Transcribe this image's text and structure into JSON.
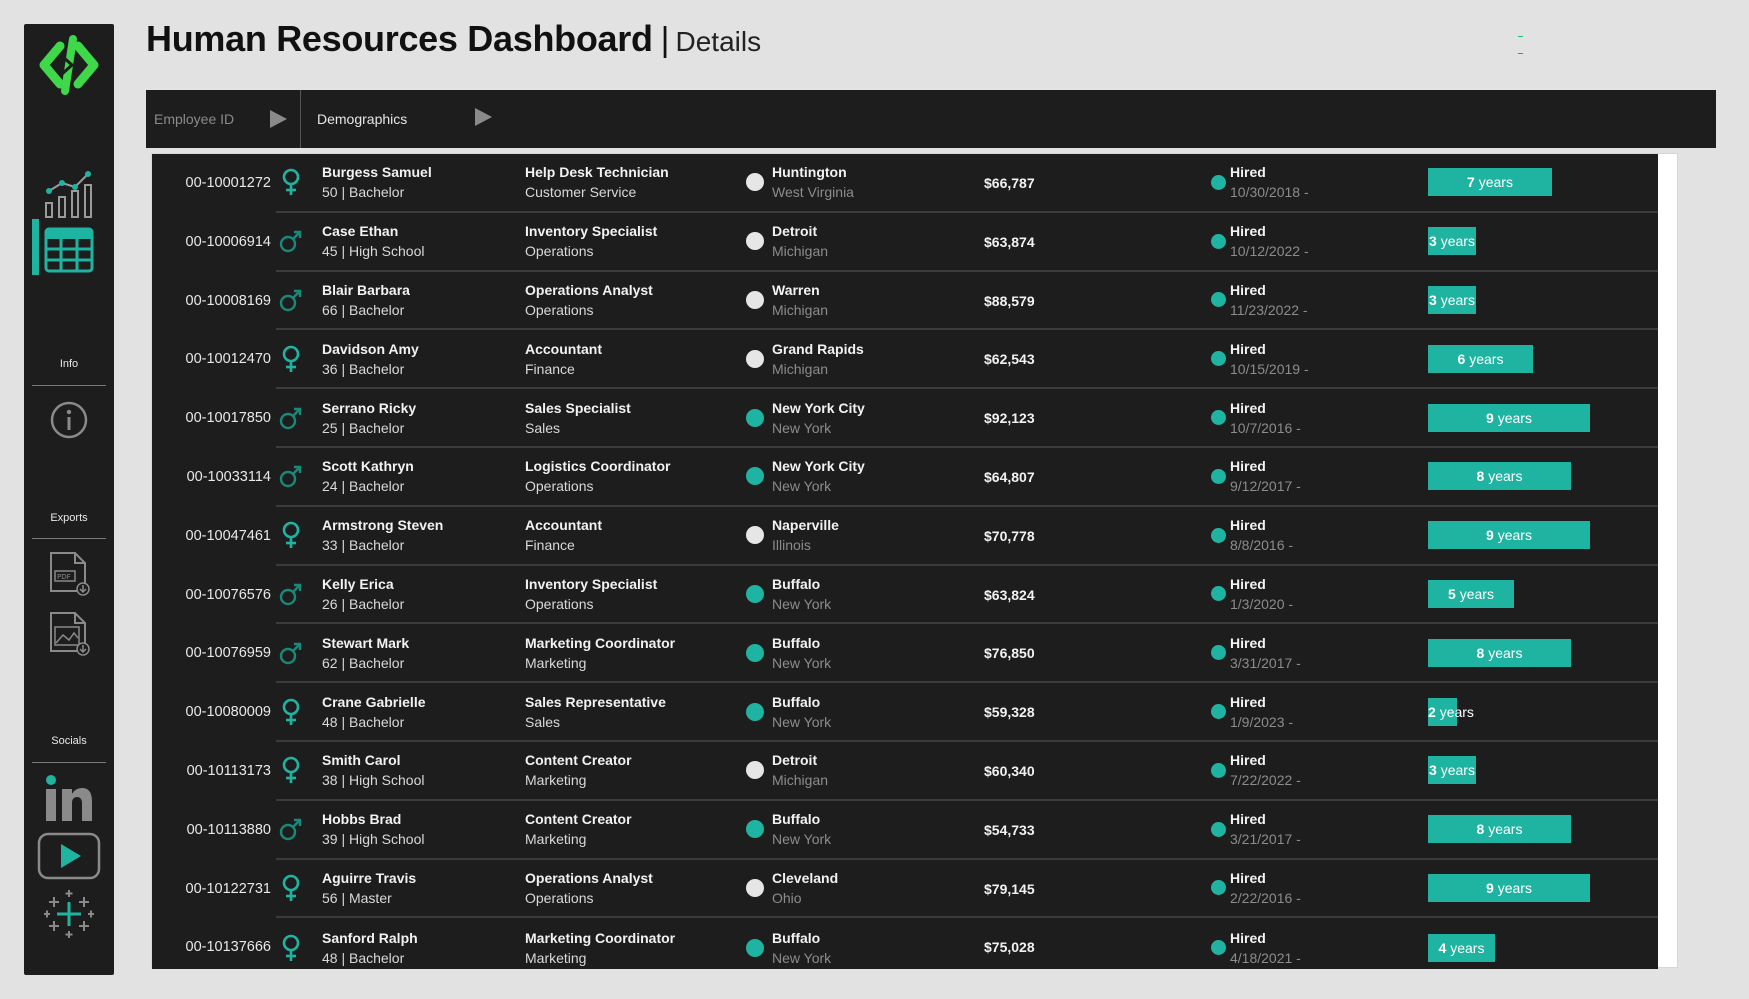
{
  "header": {
    "title": "Human Resources Dashboard",
    "separator": "|",
    "subtitle": "Details"
  },
  "colors": {
    "accent": "#1fb4a2",
    "logo_green": "#3ed84a",
    "dark_panel": "#1d1d1d",
    "location_white": "#e6e6e6",
    "corner_mark_green": "#20c070",
    "corner_mark_red": "#e05050"
  },
  "sidebar": {
    "logo_icon": "code-brackets-logo",
    "nav": [
      {
        "icon": "bar-line-chart-icon",
        "active": false
      },
      {
        "icon": "table-grid-icon",
        "active": true
      }
    ],
    "info_label": "Info",
    "info_icon": "info-icon",
    "exports_label": "Exports",
    "exports": [
      {
        "icon": "pdf-download-icon"
      },
      {
        "icon": "image-download-icon"
      }
    ],
    "socials_label": "Socials",
    "socials": [
      {
        "icon": "linkedin-icon"
      },
      {
        "icon": "youtube-play-icon"
      },
      {
        "icon": "tableau-icon"
      }
    ]
  },
  "filters": [
    {
      "label": "Employee ID",
      "icon": "play-arrow-icon"
    },
    {
      "label": "Demographics",
      "icon": "play-arrow-icon"
    }
  ],
  "rows": [
    {
      "id": "00-10001272",
      "gender": "female",
      "name": "Burgess Samuel",
      "age_edu": "50 | Bachelor",
      "title": "Help Desk Technician",
      "dept": "Customer Service",
      "loc_hq": false,
      "city": "Huntington",
      "state": "West Virginia",
      "salary": "$66,787",
      "status": "Hired",
      "date": "10/30/2018 -",
      "years_num": "7",
      "years_word": "years",
      "years": 7
    },
    {
      "id": "00-10006914",
      "gender": "male",
      "name": "Case Ethan",
      "age_edu": "45 | High School",
      "title": "Inventory Specialist",
      "dept": "Operations",
      "loc_hq": false,
      "city": "Detroit",
      "state": "Michigan",
      "salary": "$63,874",
      "status": "Hired",
      "date": "10/12/2022 -",
      "years_num": "3",
      "years_word": "years",
      "years": 3
    },
    {
      "id": "00-10008169",
      "gender": "male",
      "name": "Blair Barbara",
      "age_edu": "66 | Bachelor",
      "title": "Operations Analyst",
      "dept": "Operations",
      "loc_hq": false,
      "city": "Warren",
      "state": "Michigan",
      "salary": "$88,579",
      "status": "Hired",
      "date": "11/23/2022 -",
      "years_num": "3",
      "years_word": "years",
      "years": 3
    },
    {
      "id": "00-10012470",
      "gender": "female",
      "name": "Davidson Amy",
      "age_edu": "36 | Bachelor",
      "title": "Accountant",
      "dept": "Finance",
      "loc_hq": false,
      "city": "Grand Rapids",
      "state": "Michigan",
      "salary": "$62,543",
      "status": "Hired",
      "date": "10/15/2019 -",
      "years_num": "6",
      "years_word": "years",
      "years": 6
    },
    {
      "id": "00-10017850",
      "gender": "male",
      "name": "Serrano Ricky",
      "age_edu": "25 | Bachelor",
      "title": "Sales Specialist",
      "dept": "Sales",
      "loc_hq": true,
      "city": "New York City",
      "state": "New York",
      "salary": "$92,123",
      "status": "Hired",
      "date": "10/7/2016 -",
      "years_num": "9",
      "years_word": "years",
      "years": 9
    },
    {
      "id": "00-10033114",
      "gender": "male",
      "name": "Scott Kathryn",
      "age_edu": "24 | Bachelor",
      "title": "Logistics Coordinator",
      "dept": "Operations",
      "loc_hq": true,
      "city": "New York City",
      "state": "New York",
      "salary": "$64,807",
      "status": "Hired",
      "date": "9/12/2017 -",
      "years_num": "8",
      "years_word": "years",
      "years": 8
    },
    {
      "id": "00-10047461",
      "gender": "female",
      "name": "Armstrong Steven",
      "age_edu": "33 | Bachelor",
      "title": "Accountant",
      "dept": "Finance",
      "loc_hq": false,
      "city": "Naperville",
      "state": "Illinois",
      "salary": "$70,778",
      "status": "Hired",
      "date": "8/8/2016 -",
      "years_num": "9",
      "years_word": "years",
      "years": 9
    },
    {
      "id": "00-10076576",
      "gender": "male",
      "name": "Kelly Erica",
      "age_edu": "26 | Bachelor",
      "title": "Inventory Specialist",
      "dept": "Operations",
      "loc_hq": true,
      "city": "Buffalo",
      "state": "New York",
      "salary": "$63,824",
      "status": "Hired",
      "date": "1/3/2020 -",
      "years_num": "5",
      "years_word": "years",
      "years": 5
    },
    {
      "id": "00-10076959",
      "gender": "male",
      "name": "Stewart Mark",
      "age_edu": "62 | Bachelor",
      "title": "Marketing Coordinator",
      "dept": "Marketing",
      "loc_hq": true,
      "city": "Buffalo",
      "state": "New York",
      "salary": "$76,850",
      "status": "Hired",
      "date": "3/31/2017 -",
      "years_num": "8",
      "years_word": "years",
      "years": 8
    },
    {
      "id": "00-10080009",
      "gender": "female",
      "name": "Crane Gabrielle",
      "age_edu": "48 | Bachelor",
      "title": "Sales Representative",
      "dept": "Sales",
      "loc_hq": true,
      "city": "Buffalo",
      "state": "New York",
      "salary": "$59,328",
      "status": "Hired",
      "date": "1/9/2023 -",
      "years_num": "2",
      "years_word": "years",
      "years": 2
    },
    {
      "id": "00-10113173",
      "gender": "female",
      "name": "Smith Carol",
      "age_edu": "38 | High School",
      "title": "Content Creator",
      "dept": "Marketing",
      "loc_hq": false,
      "city": "Detroit",
      "state": "Michigan",
      "salary": "$60,340",
      "status": "Hired",
      "date": "7/22/2022 -",
      "years_num": "3",
      "years_word": "years",
      "years": 3
    },
    {
      "id": "00-10113880",
      "gender": "male",
      "name": "Hobbs Brad",
      "age_edu": "39 | High School",
      "title": "Content Creator",
      "dept": "Marketing",
      "loc_hq": true,
      "city": "Buffalo",
      "state": "New York",
      "salary": "$54,733",
      "status": "Hired",
      "date": "3/21/2017 -",
      "years_num": "8",
      "years_word": "years",
      "years": 8
    },
    {
      "id": "00-10122731",
      "gender": "female",
      "name": "Aguirre Travis",
      "age_edu": "56 | Master",
      "title": "Operations Analyst",
      "dept": "Operations",
      "loc_hq": false,
      "city": "Cleveland",
      "state": "Ohio",
      "salary": "$79,145",
      "status": "Hired",
      "date": "2/22/2016 -",
      "years_num": "9",
      "years_word": "years",
      "years": 9
    },
    {
      "id": "00-10137666",
      "gender": "female",
      "name": "Sanford Ralph",
      "age_edu": "48 | Bachelor",
      "title": "Marketing Coordinator",
      "dept": "Marketing",
      "loc_hq": true,
      "city": "Buffalo",
      "state": "New York",
      "salary": "$75,028",
      "status": "Hired",
      "date": "4/18/2021 -",
      "years_num": "4",
      "years_word": "years",
      "years": 4
    }
  ]
}
